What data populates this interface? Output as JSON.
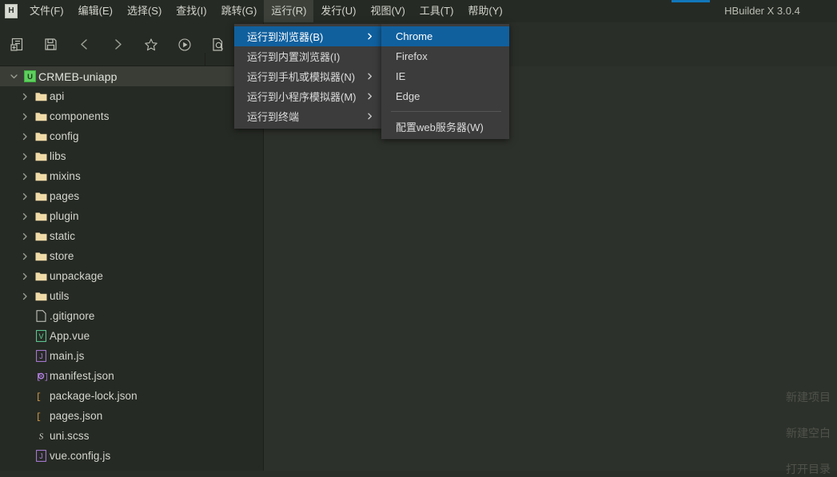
{
  "window": {
    "title": "HBuilder X 3.0.4",
    "logo_letter": "H",
    "accent_color": "#1177bb"
  },
  "menubar": {
    "items": [
      {
        "label": "文件(F)",
        "name": "menu-file",
        "active": false
      },
      {
        "label": "编辑(E)",
        "name": "menu-edit",
        "active": false
      },
      {
        "label": "选择(S)",
        "name": "menu-select",
        "active": false
      },
      {
        "label": "查找(I)",
        "name": "menu-find",
        "active": false
      },
      {
        "label": "跳转(G)",
        "name": "menu-goto",
        "active": false
      },
      {
        "label": "运行(R)",
        "name": "menu-run",
        "active": true
      },
      {
        "label": "发行(U)",
        "name": "menu-publish",
        "active": false
      },
      {
        "label": "视图(V)",
        "name": "menu-view",
        "active": false
      },
      {
        "label": "工具(T)",
        "name": "menu-tools",
        "active": false
      },
      {
        "label": "帮助(Y)",
        "name": "menu-help",
        "active": false
      }
    ]
  },
  "toolbar": {
    "buttons": [
      {
        "icon": "new-file-icon",
        "name": "new-file-button"
      },
      {
        "icon": "save-icon",
        "name": "save-button"
      },
      {
        "icon": "back-icon",
        "name": "back-button"
      },
      {
        "icon": "forward-icon",
        "name": "forward-button"
      },
      {
        "icon": "star-icon",
        "name": "favorite-button"
      },
      {
        "icon": "run-icon",
        "name": "run-button"
      },
      {
        "icon": "preview-icon",
        "name": "preview-button"
      }
    ]
  },
  "run_menu": {
    "items": [
      {
        "label": "运行到浏览器(B)",
        "has_submenu": true,
        "selected": true
      },
      {
        "label": "运行到内置浏览器(I)",
        "has_submenu": false,
        "selected": false
      },
      {
        "label": "运行到手机或模拟器(N)",
        "has_submenu": true,
        "selected": false
      },
      {
        "label": "运行到小程序模拟器(M)",
        "has_submenu": true,
        "selected": false
      },
      {
        "label": "运行到终端",
        "has_submenu": true,
        "selected": false
      }
    ]
  },
  "browser_submenu": {
    "items": [
      {
        "label": "Chrome",
        "selected": true,
        "separator_before": false
      },
      {
        "label": "Firefox",
        "selected": false,
        "separator_before": false
      },
      {
        "label": "IE",
        "selected": false,
        "separator_before": false
      },
      {
        "label": "Edge",
        "selected": false,
        "separator_before": false
      },
      {
        "label": "配置web服务器(W)",
        "selected": false,
        "separator_before": true
      }
    ]
  },
  "sidebar": {
    "root": {
      "label": "CRMEB-uniapp",
      "icon": "uniapp-project-icon",
      "expanded": true
    },
    "items": [
      {
        "label": "api",
        "icon": "folder-icon",
        "type": "folder",
        "expanded": false
      },
      {
        "label": "components",
        "icon": "folder-icon",
        "type": "folder",
        "expanded": false
      },
      {
        "label": "config",
        "icon": "folder-icon",
        "type": "folder",
        "expanded": false
      },
      {
        "label": "libs",
        "icon": "folder-icon",
        "type": "folder",
        "expanded": false
      },
      {
        "label": "mixins",
        "icon": "folder-icon",
        "type": "folder",
        "expanded": false
      },
      {
        "label": "pages",
        "icon": "folder-icon",
        "type": "folder",
        "expanded": false
      },
      {
        "label": "plugin",
        "icon": "folder-icon",
        "type": "folder",
        "expanded": false
      },
      {
        "label": "static",
        "icon": "folder-icon",
        "type": "folder",
        "expanded": false
      },
      {
        "label": "store",
        "icon": "folder-icon",
        "type": "folder",
        "expanded": false
      },
      {
        "label": "unpackage",
        "icon": "folder-icon",
        "type": "folder",
        "expanded": false
      },
      {
        "label": "utils",
        "icon": "folder-icon",
        "type": "folder",
        "expanded": false
      },
      {
        "label": ".gitignore",
        "icon": "plain-file-icon",
        "type": "file"
      },
      {
        "label": "App.vue",
        "icon": "vue-file-icon",
        "type": "file"
      },
      {
        "label": "main.js",
        "icon": "js-file-icon",
        "type": "file"
      },
      {
        "label": "manifest.json",
        "icon": "manifest-file-icon",
        "type": "file"
      },
      {
        "label": "package-lock.json",
        "icon": "json-file-icon",
        "type": "file"
      },
      {
        "label": "pages.json",
        "icon": "json-file-icon",
        "type": "file"
      },
      {
        "label": "uni.scss",
        "icon": "sass-file-icon",
        "type": "file"
      },
      {
        "label": "vue.config.js",
        "icon": "js-file-icon",
        "type": "file"
      }
    ]
  },
  "welcome_actions": [
    {
      "label": "新建项目"
    },
    {
      "label": "新建空白"
    },
    {
      "label": "打开目录"
    }
  ],
  "colors": {
    "sidebar_bg": "#262a24",
    "editor_bg": "#2d312b",
    "menu_bg": "#3c3c3c",
    "selection": "#10609e",
    "folder": "#f0dba8"
  }
}
